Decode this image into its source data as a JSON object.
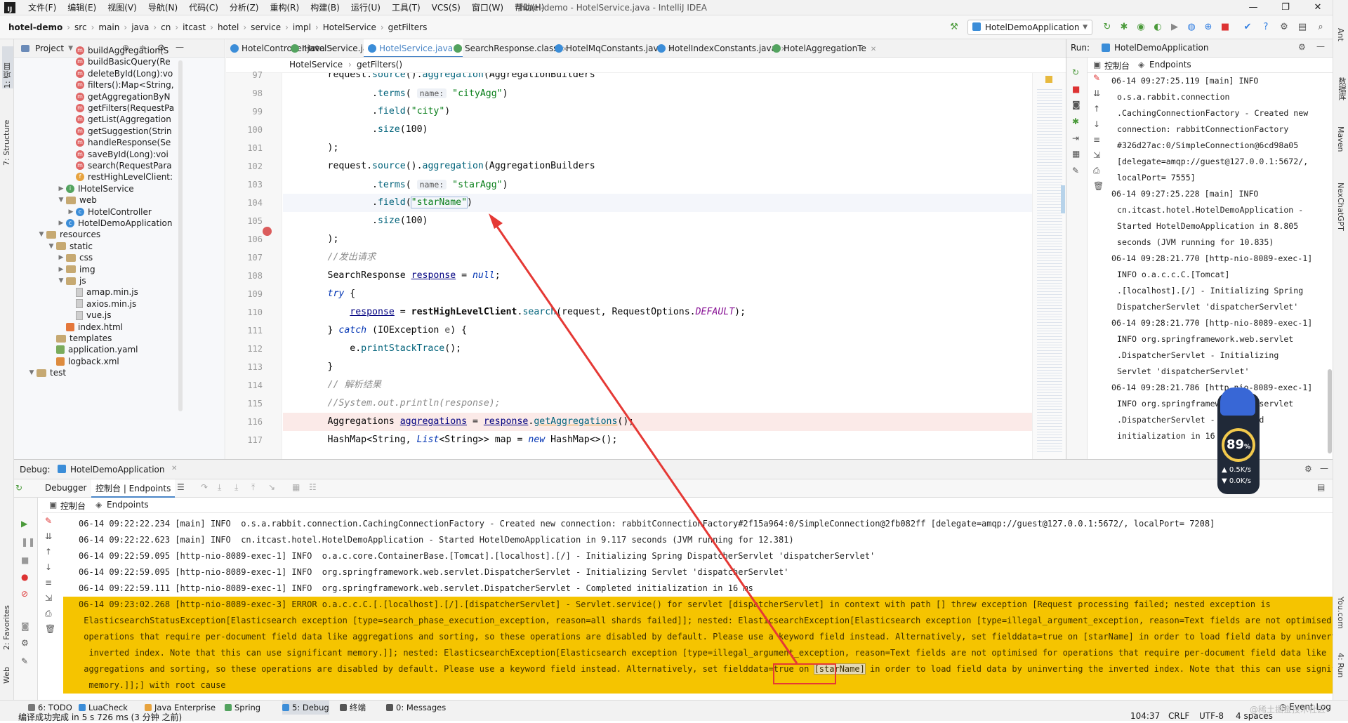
{
  "menubar": {
    "logo": "IJ",
    "items": [
      "文件(F)",
      "编辑(E)",
      "视图(V)",
      "导航(N)",
      "代码(C)",
      "分析(Z)",
      "重构(R)",
      "构建(B)",
      "运行(U)",
      "工具(T)",
      "VCS(S)",
      "窗口(W)",
      "帮助(H)"
    ],
    "title": "hotel-demo - HotelService.java - IntelliJ IDEA",
    "minimize": "—",
    "maximize": "❐",
    "close": "✕"
  },
  "navbar": {
    "crumbs": [
      "hotel-demo",
      "src",
      "main",
      "java",
      "cn",
      "itcast",
      "hotel",
      "service",
      "impl",
      "HotelService",
      "getFilters"
    ],
    "run_config": "HotelDemoApplication"
  },
  "left_strip": {
    "project_tab": "1: 项目",
    "structure_tab": "7: Structure",
    "favorites_tab": "2: Favorites",
    "web_tab": "Web"
  },
  "project": {
    "header": "Project",
    "items": [
      {
        "label": "buildAggregation(S",
        "icon": "m"
      },
      {
        "label": "buildBasicQuery(Re",
        "icon": "m"
      },
      {
        "label": "deleteById(Long):vo",
        "icon": "m"
      },
      {
        "label": "filters():Map<String,",
        "icon": "m"
      },
      {
        "label": "getAggregationByN",
        "icon": "m"
      },
      {
        "label": "getFilters(RequestPa",
        "icon": "m"
      },
      {
        "label": "getList(Aggregation",
        "icon": "m"
      },
      {
        "label": "getSuggestion(Strin",
        "icon": "m"
      },
      {
        "label": "handleResponse(Se",
        "icon": "m"
      },
      {
        "label": "saveById(Long):voi",
        "icon": "m"
      },
      {
        "label": "search(RequestPara",
        "icon": "m"
      },
      {
        "label": "restHighLevelClient:",
        "icon": "f"
      },
      {
        "label": "IHotelService",
        "icon": "i"
      },
      {
        "label": "web",
        "icon": "folder"
      },
      {
        "label": "HotelController",
        "icon": "c"
      },
      {
        "label": "HotelDemoApplication",
        "icon": "c"
      },
      {
        "label": "resources",
        "icon": "folder"
      },
      {
        "label": "static",
        "icon": "folder"
      },
      {
        "label": "css",
        "icon": "folder"
      },
      {
        "label": "img",
        "icon": "folder"
      },
      {
        "label": "js",
        "icon": "folder"
      },
      {
        "label": "amap.min.js",
        "icon": "file"
      },
      {
        "label": "axios.min.js",
        "icon": "file"
      },
      {
        "label": "vue.js",
        "icon": "file"
      },
      {
        "label": "index.html",
        "icon": "html"
      },
      {
        "label": "templates",
        "icon": "folder"
      },
      {
        "label": "application.yaml",
        "icon": "yml"
      },
      {
        "label": "logback.xml",
        "icon": "xml"
      },
      {
        "label": "test",
        "icon": "folder"
      }
    ]
  },
  "editor": {
    "tabs": [
      {
        "label": "HotelController.java",
        "color": "#3b8dd8"
      },
      {
        "label": "IHotelService.java",
        "color": "#53a35f"
      },
      {
        "label": "HotelService.java",
        "color": "#3b8dd8"
      },
      {
        "label": "SearchResponse.class",
        "color": "#53a35f"
      },
      {
        "label": "HotelMqConstants.java",
        "color": "#3b8dd8"
      },
      {
        "label": "HotelIndexConstants.java",
        "color": "#3b8dd8"
      },
      {
        "label": "HotelAggregationTe",
        "color": "#53a35f"
      }
    ],
    "breadcrumb": [
      "HotelService",
      "getFilters()"
    ],
    "line_numbers": [
      "97",
      "98",
      "99",
      "100",
      "101",
      "102",
      "103",
      "104",
      "105",
      "106",
      "107",
      "108",
      "109",
      "110",
      "111",
      "112",
      "113",
      "114",
      "115",
      "116",
      "117"
    ],
    "code": {
      "l97a": "        request.",
      "l97b": "source",
      "l97c": "().",
      "l97d": "aggregation",
      "l97e": "(AggregationBuilders",
      "l98a": "                .",
      "l98b": "terms",
      "l98c": "( ",
      "l98hint": "name:",
      "l98d": " ",
      "l98s": "\"cityAgg\"",
      "l98e": ")",
      "l99a": "                .",
      "l99b": "field",
      "l99c": "(",
      "l99s": "\"city\"",
      "l99e": ")",
      "l100a": "                .",
      "l100b": "size",
      "l100c": "(100)",
      "l101": "        );",
      "l102a": "        request.",
      "l102b": "source",
      "l102c": "().",
      "l102d": "aggregation",
      "l102e": "(AggregationBuilders",
      "l103a": "                .",
      "l103b": "terms",
      "l103c": "( ",
      "l103hint": "name:",
      "l103d": " ",
      "l103s": "\"starAgg\"",
      "l103e": ")",
      "l104a": "                .",
      "l104b": "field",
      "l104c": "(",
      "l104s": "\"starName\"",
      "l104e": ")",
      "l105a": "                .",
      "l105b": "size",
      "l105c": "(100)",
      "l106": "        );",
      "l107": "        //发出请求",
      "l108a": "        SearchResponse ",
      "l108b": "response",
      "l108c": " = ",
      "l108d": "null",
      "l108e": ";",
      "l109a": "        ",
      "l109b": "try",
      "l109c": " {",
      "l110a": "            ",
      "l110b": "response",
      "l110c": " = ",
      "l110d": "restHighLevelClient",
      "l110e": ".",
      "l110f": "search",
      "l110g": "(request, RequestOptions.",
      "l110h": "DEFAULT",
      "l110i": ");",
      "l111a": "        } ",
      "l111b": "catch",
      "l111c": " (IOException ",
      "l111d": "e",
      "l111e": ") {",
      "l112a": "            e.",
      "l112b": "printStackTrace",
      "l112c": "();",
      "l113": "        }",
      "l114": "        // 解析结果",
      "l115": "        //System.out.println(response);",
      "l116a": "        Aggregations ",
      "l116b": "aggregations",
      "l116c": " = ",
      "l116d": "response",
      "l116e": ".",
      "l116f": "getAggregations",
      "l116g": "();",
      "l117a": "        HashMap<String, ",
      "l117b": "List",
      "l117c": "<String>> map = ",
      "l117d": "new",
      "l117e": " HashMap<>();"
    }
  },
  "run_panel": {
    "label": "Run:",
    "app": "HotelDemoApplication",
    "console_tab": "控制台",
    "endpoints_tab": "Endpoints",
    "log": [
      {
        "t": "06-14 09:27:25.119 [main] INFO",
        "i": false
      },
      {
        "t": "o.s.a.rabbit.connection",
        "i": true
      },
      {
        "t": ".CachingConnectionFactory - Created new",
        "i": true
      },
      {
        "t": "connection: rabbitConnectionFactory",
        "i": true
      },
      {
        "t": "#326d27ac:0/SimpleConnection@6cd98a05",
        "i": true
      },
      {
        "t": "[delegate=amqp://guest@127.0.0.1:5672/,",
        "i": true
      },
      {
        "t": "localPort= 7555]",
        "i": true
      },
      {
        "t": "06-14 09:27:25.228 [main] INFO",
        "i": false
      },
      {
        "t": "cn.itcast.hotel.HotelDemoApplication -",
        "i": true
      },
      {
        "t": "Started HotelDemoApplication in 8.805",
        "i": true
      },
      {
        "t": "seconds (JVM running for 10.835)",
        "i": true
      },
      {
        "t": "06-14 09:28:21.770 [http-nio-8089-exec-1]",
        "i": false
      },
      {
        "t": " INFO  o.a.c.c.C.[Tomcat]",
        "i": true
      },
      {
        "t": ".[localhost].[/] - Initializing Spring",
        "i": true
      },
      {
        "t": "DispatcherServlet 'dispatcherServlet'",
        "i": true
      },
      {
        "t": "06-14 09:28:21.770 [http-nio-8089-exec-1]",
        "i": false
      },
      {
        "t": " INFO  org.springframework.web.servlet",
        "i": true
      },
      {
        "t": ".DispatcherServlet - Initializing",
        "i": true
      },
      {
        "t": "Servlet 'dispatcherServlet'",
        "i": true
      },
      {
        "t": "06-14 09:28:21.786 [http-nio-8089-exec-1]",
        "i": false
      },
      {
        "t": " INFO  org.springframework.web.servlet",
        "i": true
      },
      {
        "t": ".DispatcherServlet - Completed",
        "i": true
      },
      {
        "t": "initialization in 16 ms",
        "i": true
      }
    ]
  },
  "right_strip": [
    "Ant",
    "数据库",
    "Maven",
    "NexChatGPT",
    "You.com",
    "4: Run"
  ],
  "debug": {
    "label": "Debug:",
    "app": "HotelDemoApplication",
    "debugger_tab": "Debugger",
    "console_endpoints_tab": "控制台 | Endpoints",
    "console_tab": "控制台",
    "endpoints_tab": "Endpoints",
    "log": [
      {
        "t": "06-14 09:22:22.234 [main] INFO  o.s.a.rabbit.connection.CachingConnectionFactory - Created new connection: rabbitConnectionFactory#2f15a964:0/SimpleConnection@2fb082ff [delegate=amqp://guest@127.0.0.1:5672/, localPort= 7208]",
        "e": false
      },
      {
        "t": "06-14 09:22:22.623 [main] INFO  cn.itcast.hotel.HotelDemoApplication - Started HotelDemoApplication in 9.117 seconds (JVM running for 12.381)",
        "e": false
      },
      {
        "t": "06-14 09:22:59.095 [http-nio-8089-exec-1] INFO  o.a.c.core.ContainerBase.[Tomcat].[localhost].[/] - Initializing Spring DispatcherServlet 'dispatcherServlet'",
        "e": false
      },
      {
        "t": "06-14 09:22:59.095 [http-nio-8089-exec-1] INFO  org.springframework.web.servlet.DispatcherServlet - Initializing Servlet 'dispatcherServlet'",
        "e": false
      },
      {
        "t": "06-14 09:22:59.111 [http-nio-8089-exec-1] INFO  org.springframework.web.servlet.DispatcherServlet - Completed initialization in 16 ms",
        "e": false
      },
      {
        "t": "06-14 09:23:02.268 [http-nio-8089-exec-3] ERROR o.a.c.c.C.[.[localhost].[/].[dispatcherServlet] - Servlet.service() for servlet [dispatcherServlet] in context with path [] threw exception [Request processing failed; nested exception is",
        "e": true
      },
      {
        "t": " ElasticsearchStatusException[Elasticsearch exception [type=search_phase_execution_exception, reason=all shards failed]]; nested: ElasticsearchException[Elasticsearch exception [type=illegal_argument_exception, reason=Text fields are not optimised for",
        "e": true
      },
      {
        "t": " operations that require per-document field data like aggregations and sorting, so these operations are disabled by default. Please use a keyword field instead. Alternatively, set fielddata=true on [starName] in order to load field data by uninverting the",
        "e": true
      },
      {
        "t": "  inverted index. Note that this can use significant memory.]]; nested: ElasticsearchException[Elasticsearch exception [type=illegal_argument_exception, reason=Text fields are not optimised for operations that require per-document field data like",
        "e": true
      },
      {
        "t": " aggregations and sorting, so these operations are disabled by default. Please use a keyword field instead. Alternatively, set fielddata=true on ",
        "e": true,
        "hl": "[starName]",
        "tail": " in order to load field data by uninverting the inverted index. Note that this can use significant"
      },
      {
        "t": "  memory.]];] with root cause",
        "e": true
      }
    ]
  },
  "widget": {
    "percent": "89",
    "unit": "%",
    "up": "0.5",
    "up_unit": "K/s",
    "down": "0.0",
    "down_unit": "K/s"
  },
  "statusbar": {
    "tabs": [
      "6: TODO",
      "LuaCheck",
      "Java Enterprise",
      "Spring",
      "5: Debug",
      "终端",
      "0: Messages"
    ],
    "event_log": "Event Log",
    "message": "编译成功完成 in 5 s 726 ms (3 分钟 之前)",
    "position": "104:37",
    "line_sep": "CRLF",
    "encoding": "UTF-8",
    "indent": "4 spaces",
    "watermark": "@稀土掘金技术社区"
  }
}
